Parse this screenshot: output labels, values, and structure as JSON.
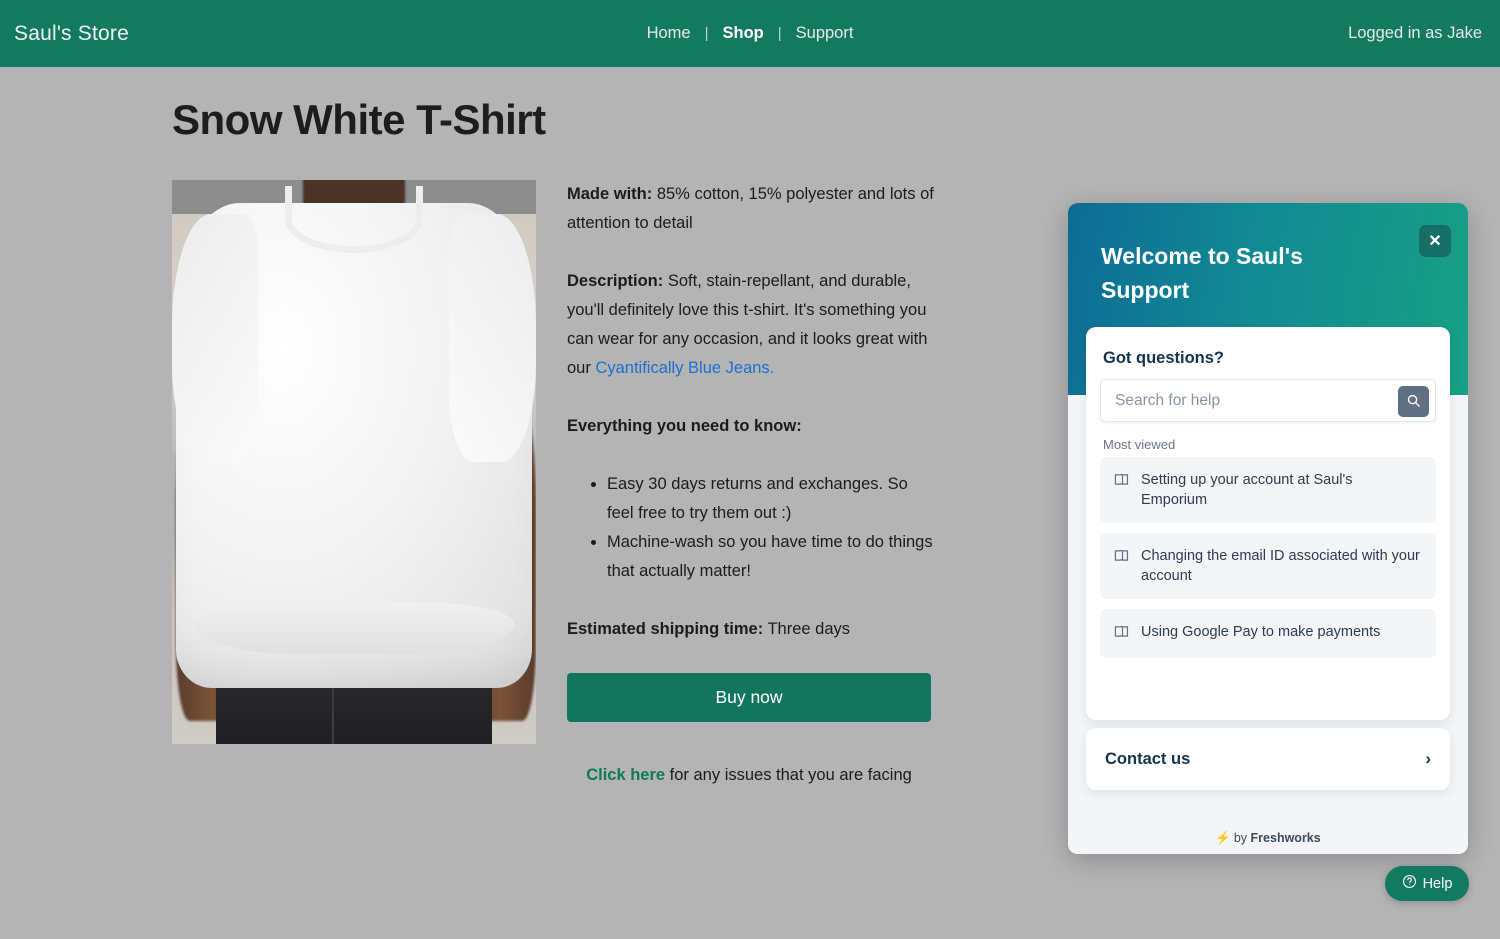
{
  "navbar": {
    "brand": "Saul's Store",
    "links": [
      {
        "label": "Home",
        "active": false
      },
      {
        "label": "Shop",
        "active": true
      },
      {
        "label": "Support",
        "active": false
      }
    ],
    "separator": "|",
    "user_status": "Logged in as Jake",
    "background_color": "#137a5e"
  },
  "product": {
    "title": "Snow White T-Shirt",
    "image_alt": "Man wearing a plain white t-shirt",
    "made_with_label": "Made with:",
    "made_with_text": " 85% cotton, 15% polyester and lots of attention to detail",
    "description_label": "Description:",
    "description_text": " Soft, stain-repellant, and durable, you'll definitely love this t-shirt. It's something you can wear for any occasion, and it looks great with our ",
    "description_link": "Cyantifically Blue Jeans.",
    "need_to_know_label": "Everything you need to know:",
    "bullets": [
      "Easy 30 days returns and exchanges. So feel free to try them out :)",
      "Machine-wash so you have time to do things that actually matter!"
    ],
    "shipping_label": "Estimated shipping time:",
    "shipping_value": " Three days",
    "buy_button": "Buy now",
    "issue_link": "Click here",
    "issue_text": " for any issues that you are facing",
    "link_color": "#1b6fd1",
    "accent_color": "#11765c"
  },
  "support_widget": {
    "title": "Welcome to Saul's Support",
    "close_label": "✕",
    "header_gradient_from": "#0d6b96",
    "header_gradient_to": "#18a183",
    "got_questions": "Got questions?",
    "search": {
      "value": "",
      "placeholder": "Search for help",
      "button_icon": "search-icon"
    },
    "most_viewed_label": "Most viewed",
    "articles": [
      {
        "title": "Setting up your account at Saul's Emporium",
        "icon": "book-icon"
      },
      {
        "title": "Changing the email ID associated with your account",
        "icon": "book-icon"
      },
      {
        "title": "Using Google Pay to make payments",
        "icon": "book-icon"
      }
    ],
    "contact_us": "Contact us",
    "contact_chevron": "›",
    "footer_bolt": "⚡",
    "footer_by": "by ",
    "footer_brand": "Freshworks"
  },
  "help_launcher": {
    "label": "Help",
    "icon": "question-circle-icon",
    "background_color": "#127a5f"
  }
}
